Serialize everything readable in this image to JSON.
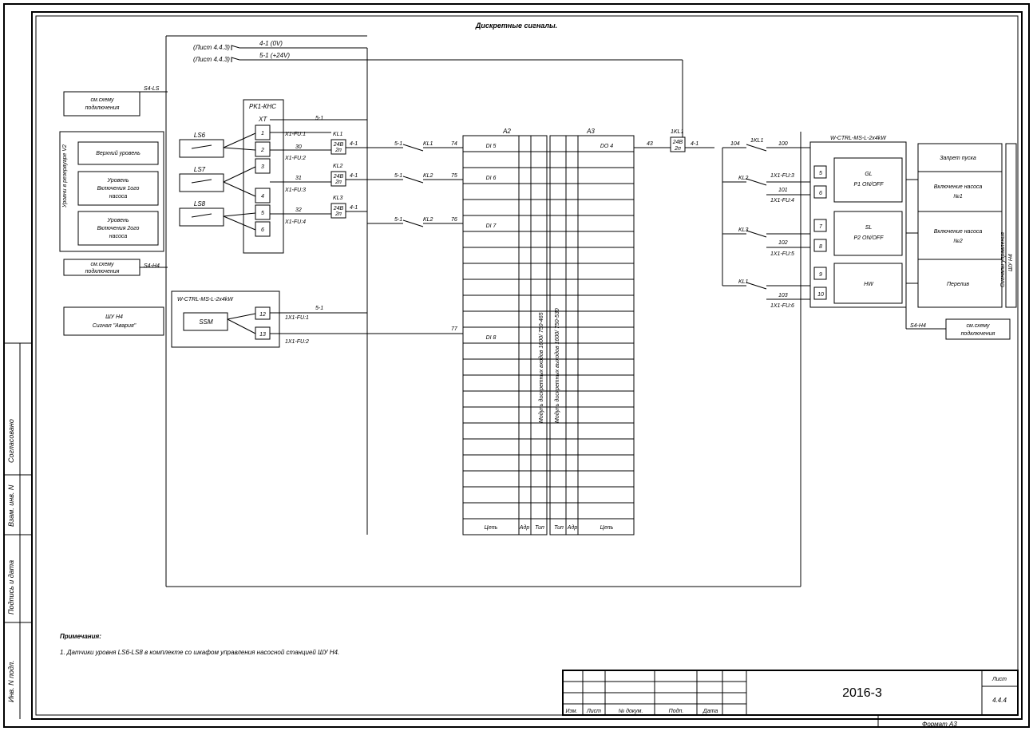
{
  "title": "Дискретные сигналы.",
  "busLabels": {
    "sheetRef": "(Лист 4.4.3)",
    "v0": "4-1 (0V)",
    "v24": "5-1 (+24V)"
  },
  "leftBoxes": {
    "schemeRef": "см.схему\nподключения",
    "shunt": "ШУ Н4\nСигнал \"Авария\"",
    "schemeRef2": "см.схему\nподключения"
  },
  "tankLabel": "Уровни в резервуаре V2",
  "levels": {
    "l1": "Верхний уровень",
    "l2": "Уровень\nВключения 1ого\nнасоса",
    "l3": "Уровень\nВключения 2ого\nнасоса"
  },
  "sensors": {
    "s1": "LS6",
    "s2": "LS7",
    "s3": "LS8",
    "ssm": "SSM"
  },
  "pk1": {
    "title": "PK1-КНС",
    "xt": "XT",
    "t1": "1",
    "t2": "2",
    "t3": "3",
    "t4": "4",
    "t5": "5",
    "t6": "6"
  },
  "wctrl1": {
    "title": "W-CTRL-MS-L-2x4kW",
    "t12": "12",
    "t13": "13"
  },
  "wctrl2": {
    "title": "W-CTRL-MS-L-2x4kW",
    "t5": "5",
    "t6": "6",
    "t7": "7",
    "t8": "8",
    "t9": "9",
    "t10": "10",
    "gl": "GL\nP1 ON/OFF",
    "sl": "SL\nP2 ON/OFF",
    "hw": "HW"
  },
  "fuses": {
    "f1": "X1-FU:1",
    "f2": "X1-FU:2",
    "f3": "X1-FU:3",
    "f4": "X1-FU:4",
    "ff1": "1X1-FU:1",
    "ff2": "1X1-FU:2",
    "ff3": "1X1-FU:3",
    "ff4": "1X1-FU:4",
    "ff5": "1X1-FU:5",
    "ff6": "1X1-FU:6"
  },
  "wires": {
    "w30": "30",
    "w31": "31",
    "w32": "32",
    "w74": "74",
    "w75": "75",
    "w76": "76",
    "w77": "77",
    "w43": "43",
    "w100": "100",
    "w101": "101",
    "w102": "102",
    "w103": "103",
    "w104": "104"
  },
  "lbl": {
    "kl1": "KL1",
    "kl2": "KL2",
    "kl3": "KL3",
    "k1kl1": "1KL1",
    "b51": "5-1",
    "b41": "4-1",
    "v24": "24В\n2п"
  },
  "modules": {
    "a2": "A2",
    "a3": "A3",
    "di5": "DI 5",
    "di6": "DI 6",
    "di7": "DI 7",
    "di8": "DI 8",
    "do4": "DO 4",
    "lbl1": "Модуль дискретных входов 1600/ 750-465",
    "lbl2": "Модуль дискретных выходов 1600/ 750-530",
    "h1": "Цепь",
    "h2": "Адр",
    "h3": "Тип"
  },
  "right": {
    "title": "ШУ Н4\nСигналы управления",
    "r1": "Запрет пуска",
    "r2": "Включение насоса\n№1",
    "r3": "Включение насоса\n№2",
    "r4": "Перелив",
    "ref": "см.схему\nподключения",
    "s4h4": "S4-H4"
  },
  "links": {
    "s4ls": "S4-LS",
    "s4h4": "S4-H4"
  },
  "notes": {
    "h": "Примечания:",
    "n1": "1. Датчики уровня LS6-LS8 в комплекте со шкафом управления насосной станцией ШУ Н4."
  },
  "tb": {
    "proj": "2016-3",
    "sheet": "Лист",
    "sheetNo": "4.4.4",
    "format": "Формат А3",
    "izm": "Изм.",
    "list": "Лист",
    "ndoc": "№ докум.",
    "podp": "Подп.",
    "data": "Дата"
  },
  "stamps": {
    "s1": "Согласовано",
    "s2": "Взам. инв. N",
    "s3": "Подпись и дата",
    "s4": "Инв. N подл."
  }
}
